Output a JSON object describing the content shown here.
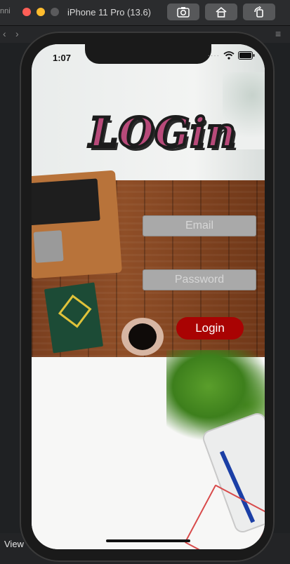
{
  "simulator": {
    "device_title": "iPhone 11 Pro (13.6)",
    "left_edge_text": "nni",
    "bottom_left_label": "View"
  },
  "status_bar": {
    "time": "1:07",
    "wifi_icon": "wifi-icon",
    "battery_icon": "battery-icon"
  },
  "login_screen": {
    "logo_text": "LOGin",
    "email_placeholder": "Email",
    "password_placeholder": "Password",
    "login_button_label": "Login",
    "login_button_color": "#a90303"
  },
  "toolbar_icons": [
    "screenshot-icon",
    "home-icon",
    "rotate-icon"
  ]
}
